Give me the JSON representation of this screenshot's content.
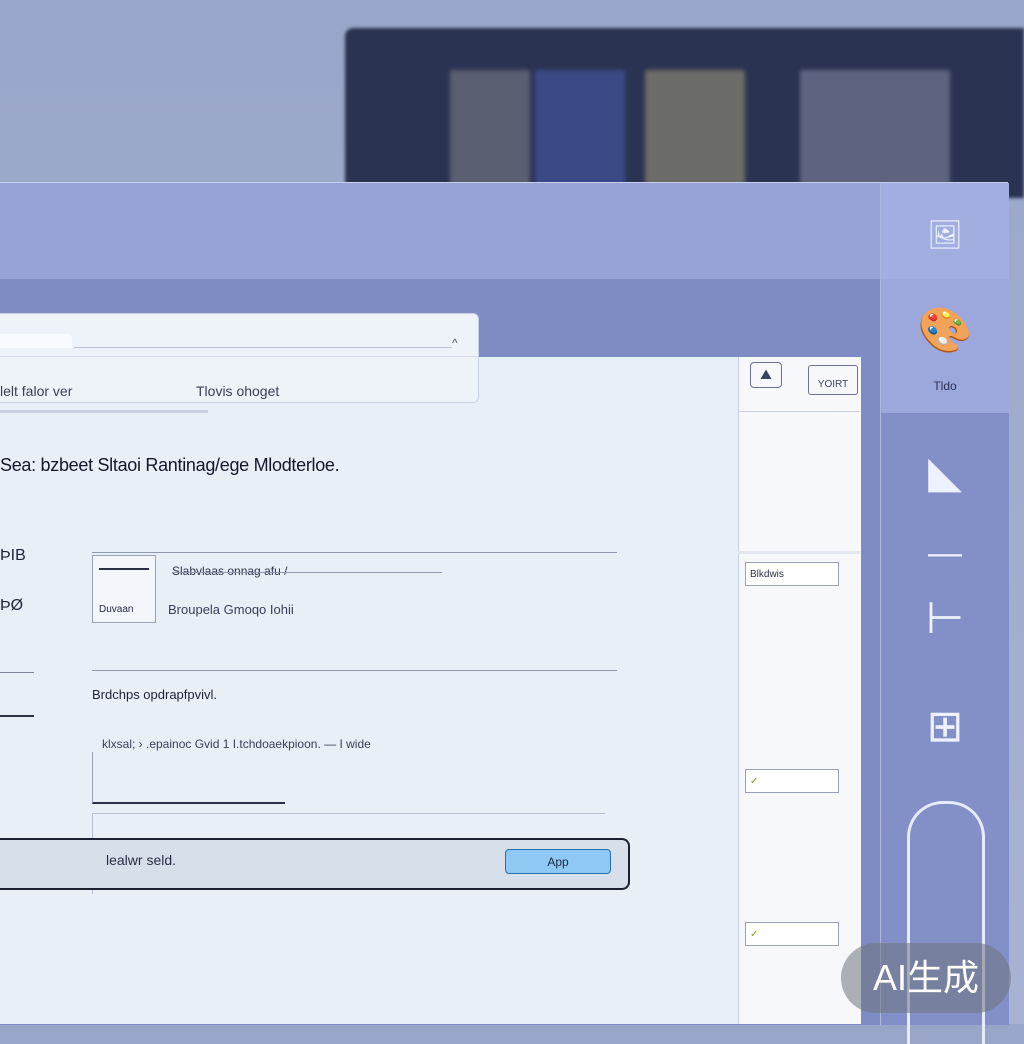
{
  "address_bar": {
    "left_text": "lelt falor ver",
    "right_text": "Tlovis ohoget",
    "caret": "^"
  },
  "document": {
    "headline": "Sea: bzbeet Sltaoi Rantinag/ege  Mlodterloe.",
    "left_labels": [
      "ÞIB",
      "ÞØ"
    ],
    "thumbnail_label": "Duvaan",
    "meta_title": "Slabvlaas onnag afu /",
    "meta_row": "Broupela   Gmoqo   Iohii",
    "section_title": "Brdchps opdrapfpvivl.",
    "row_text": "klxsal;  ›   .epainoc   Gvid    1  I.tchdoaekpioon.   —  I wide"
  },
  "command_bar": {
    "input_text": "lealwr seld.",
    "button_label": "App"
  },
  "side_panel": {
    "top_tab_label": "YOIRT",
    "field_1": "Blkdwis",
    "field_2_mark": "✓",
    "field_3_mark": "✓"
  },
  "right_rail": {
    "selected_caption": "Tldo"
  },
  "watermark": {
    "text": "AI生成"
  },
  "colors": {
    "window_frame": "#7f8cc4",
    "rail": "#8390c8",
    "doc_bg": "#e8eff7",
    "button_fill": "#8fc8f2"
  }
}
